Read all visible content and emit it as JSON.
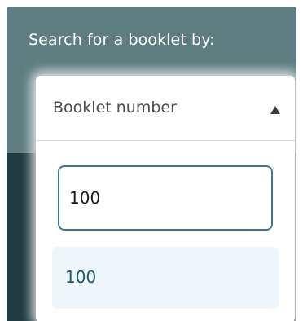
{
  "search_label": "Search for a booklet by:",
  "dropdown": {
    "selected": "Booklet number",
    "caret_icon": "caret-up-icon"
  },
  "search": {
    "value": "100",
    "placeholder": ""
  },
  "results": [
    {
      "label": "100"
    }
  ],
  "colors": {
    "header_bg": "#5e7d80",
    "dark_bg": "#1f3a40",
    "input_border": "#3b7a8e",
    "result_bg": "#eef6fc",
    "result_text": "#1d5a6e"
  }
}
